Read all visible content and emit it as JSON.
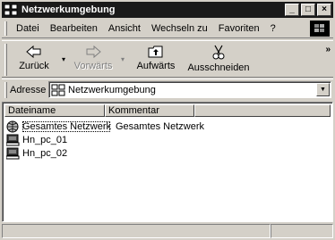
{
  "window": {
    "title": "Netzwerkumgebung",
    "controls": [
      "_",
      "□",
      "×"
    ]
  },
  "menubar": {
    "items": [
      {
        "label": "Datei"
      },
      {
        "label": "Bearbeiten"
      },
      {
        "label": "Ansicht"
      },
      {
        "label": "Wechseln zu"
      },
      {
        "label": "Favoriten"
      },
      {
        "label": "?"
      }
    ]
  },
  "toolbar": {
    "back_label": "Zurück",
    "forward_label": "Vorwärts",
    "up_label": "Aufwärts",
    "cut_label": "Ausschneiden",
    "more": "»"
  },
  "address": {
    "label": "Adresse",
    "value": "Netzwerkumgebung"
  },
  "list": {
    "columns": [
      {
        "label": "Dateiname"
      },
      {
        "label": "Kommentar"
      },
      {
        "label": ""
      }
    ],
    "rows": [
      {
        "name": "Gesamtes Netzwerk",
        "comment": "Gesamtes Netzwerk",
        "icon": "globe-network-icon"
      },
      {
        "name": "Hn_pc_01",
        "comment": "",
        "icon": "computer-icon"
      },
      {
        "name": "Hn_pc_02",
        "comment": "",
        "icon": "computer-icon"
      }
    ]
  },
  "colors": {
    "titlebar": "#1a1a1a",
    "face": "#d4d0c8"
  }
}
